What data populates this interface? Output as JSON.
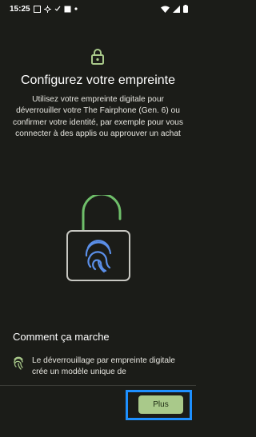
{
  "status_bar": {
    "time": "15:25",
    "icons": [
      "notification-icon",
      "settings-icon",
      "check-icon",
      "screen-icon",
      "dot-icon",
      "wifi-icon",
      "signal-icon",
      "battery-icon"
    ]
  },
  "page": {
    "title": "Configurez votre empreinte",
    "description": "Utilisez votre empreinte digitale pour déverrouiller votre The Fairphone (Gen. 6) ou confirmer votre identité, par exemple pour vous connecter à des applis ou approuver un achat"
  },
  "how_it_works": {
    "title": "Comment ça marche",
    "items": [
      {
        "icon": "fingerprint-icon",
        "text": "Le déverrouillage par empreinte digitale crée un modèle unique de"
      }
    ]
  },
  "footer": {
    "more_label": "Plus"
  },
  "colors": {
    "background": "#1b1c18",
    "accent_green": "#a9c98a",
    "lock_green": "#6fbf6a",
    "fingerprint_blue": "#5b8fe8",
    "highlight": "#1e90ff"
  }
}
